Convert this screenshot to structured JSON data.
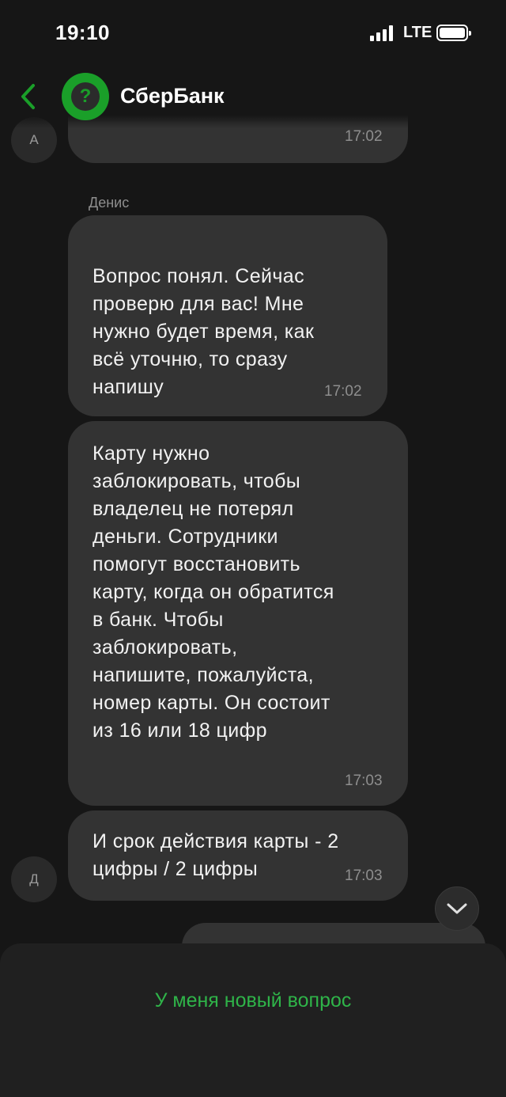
{
  "status_bar": {
    "time": "19:10",
    "network": "LTE",
    "icons": [
      "signal-bars-icon",
      "battery-icon"
    ]
  },
  "header": {
    "back_icon": "chevron-left-icon",
    "logo_icon": "question-mark-icon",
    "title": "СберБанк"
  },
  "messages": [
    {
      "avatar": "А",
      "text": "",
      "time": "17:02"
    },
    {
      "sender": "Денис",
      "text": "Вопрос понял. Сейчас\nпроверю для вас! Мне\nнужно будет время, как\nвсё уточню, то сразу\nнапишу",
      "time": "17:02"
    },
    {
      "text": "Карту нужно\nзаблокировать, чтобы\nвладелец не потерял\nденьги. Сотрудники\nпомогут восстановить\nкарту, когда он обратится\nв банк. Чтобы\nзаблокировать,\nнапишите, пожалуйста,\nномер карты. Он состоит\nиз 16 или 18 цифр",
      "time": "17:03"
    },
    {
      "avatar": "Д",
      "text": "И срок действия карты - 2\nцифры / 2 цифры",
      "time": "17:03"
    }
  ],
  "scroll_down_icon": "chevron-down-icon",
  "bottom": {
    "new_question_label": "У меня новый вопрос"
  },
  "colors": {
    "background": "#161616",
    "bubble": "#333333",
    "accent_green": "#1a9f29",
    "button_text_green": "#2fb449",
    "timestamp": "#8e8e8e"
  }
}
